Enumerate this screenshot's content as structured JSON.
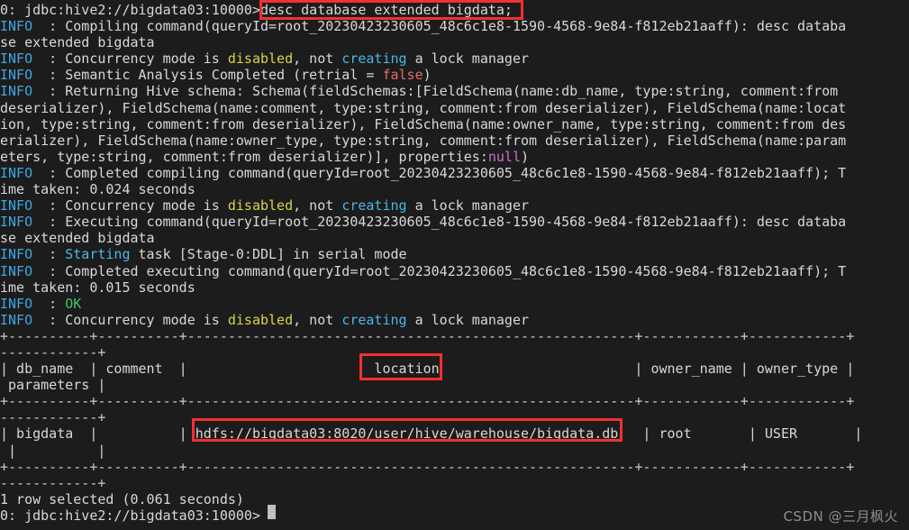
{
  "terminal": {
    "title": "hive beeline terminal",
    "prompt": "0: jdbc:hive2://bigdata03:10000>",
    "watermark": "CSDN @三月枫火",
    "colors": {
      "background": "#1c1c1c",
      "foreground": "#d8d8d8",
      "info": "#3fa7e0",
      "cyan": "#49b6e8",
      "yellow": "#d7d44a",
      "red": "#e06c6c",
      "magenta": "#d06fd0",
      "green": "#3fc66a",
      "highlight_box": "#f23030"
    },
    "command": "desc database extended bigdata;",
    "query_id": "root_20230423230605_48c6c1e8-1590-4568-9e84-f812eb21aaff",
    "compile_time": "0.024 seconds",
    "execute_time": "0.015 seconds",
    "result_status": "1 row selected (0.061 seconds)",
    "lines": [
      [
        {
          "t": "0: jdbc:hive2://bigdata03:10000>",
          "c": "c-default"
        },
        {
          "t": "desc database extended bigdata;",
          "c": "c-default"
        }
      ],
      [
        {
          "t": "INFO",
          "c": "c-info"
        },
        {
          "t": "  : Compiling command(queryId=root_20230423230605_48c6c1e8-1590-4568-9e84-f812eb21aaff): desc databa",
          "c": "c-default"
        }
      ],
      [
        {
          "t": "se extended bigdata",
          "c": "c-default"
        }
      ],
      [
        {
          "t": "INFO",
          "c": "c-info"
        },
        {
          "t": "  : Concurrency mode is ",
          "c": "c-default"
        },
        {
          "t": "disabled",
          "c": "c-yellow"
        },
        {
          "t": ", not ",
          "c": "c-default"
        },
        {
          "t": "creating",
          "c": "c-cyan"
        },
        {
          "t": " a lock manager",
          "c": "c-default"
        }
      ],
      [
        {
          "t": "INFO",
          "c": "c-info"
        },
        {
          "t": "  : Semantic Analysis Completed (retrial = ",
          "c": "c-default"
        },
        {
          "t": "false",
          "c": "c-red"
        },
        {
          "t": ")",
          "c": "c-default"
        }
      ],
      [
        {
          "t": "INFO",
          "c": "c-info"
        },
        {
          "t": "  : Returning Hive schema: Schema(fieldSchemas:[FieldSchema(name:db_name, type:string, comment:from",
          "c": "c-default"
        }
      ],
      [
        {
          "t": "deserializer), FieldSchema(name:comment, type:string, comment:from deserializer), FieldSchema(name:locat",
          "c": "c-default"
        }
      ],
      [
        {
          "t": "ion, type:string, comment:from deserializer), FieldSchema(name:owner_name, type:string, comment:from des",
          "c": "c-default"
        }
      ],
      [
        {
          "t": "erializer), FieldSchema(name:owner_type, type:string, comment:from deserializer), FieldSchema(name:param",
          "c": "c-default"
        }
      ],
      [
        {
          "t": "eters, type:string, comment:from deserializer)], properties:",
          "c": "c-default"
        },
        {
          "t": "null",
          "c": "c-magenta"
        },
        {
          "t": ")",
          "c": "c-default"
        }
      ],
      [
        {
          "t": "INFO",
          "c": "c-info"
        },
        {
          "t": "  : Completed compiling command(queryId=root_20230423230605_48c6c1e8-1590-4568-9e84-f812eb21aaff); T",
          "c": "c-default"
        }
      ],
      [
        {
          "t": "ime taken: 0.024 seconds",
          "c": "c-default"
        }
      ],
      [
        {
          "t": "INFO",
          "c": "c-info"
        },
        {
          "t": "  : Concurrency mode is ",
          "c": "c-default"
        },
        {
          "t": "disabled",
          "c": "c-yellow"
        },
        {
          "t": ", not ",
          "c": "c-default"
        },
        {
          "t": "creating",
          "c": "c-cyan"
        },
        {
          "t": " a lock manager",
          "c": "c-default"
        }
      ],
      [
        {
          "t": "INFO",
          "c": "c-info"
        },
        {
          "t": "  : Executing command(queryId=root_20230423230605_48c6c1e8-1590-4568-9e84-f812eb21aaff): desc databa",
          "c": "c-default"
        }
      ],
      [
        {
          "t": "se extended bigdata",
          "c": "c-default"
        }
      ],
      [
        {
          "t": "INFO",
          "c": "c-info"
        },
        {
          "t": "  : ",
          "c": "c-default"
        },
        {
          "t": "Starting",
          "c": "c-cyan"
        },
        {
          "t": " task [Stage-0:DDL] in serial mode",
          "c": "c-default"
        }
      ],
      [
        {
          "t": "INFO",
          "c": "c-info"
        },
        {
          "t": "  : Completed executing command(queryId=root_20230423230605_48c6c1e8-1590-4568-9e84-f812eb21aaff); T",
          "c": "c-default"
        }
      ],
      [
        {
          "t": "ime taken: 0.015 seconds",
          "c": "c-default"
        }
      ],
      [
        {
          "t": "INFO",
          "c": "c-info"
        },
        {
          "t": "  : ",
          "c": "c-default"
        },
        {
          "t": "OK",
          "c": "c-green"
        }
      ],
      [
        {
          "t": "INFO",
          "c": "c-info"
        },
        {
          "t": "  : Concurrency mode is ",
          "c": "c-default"
        },
        {
          "t": "disabled",
          "c": "c-yellow"
        },
        {
          "t": ", not ",
          "c": "c-default"
        },
        {
          "t": "creating",
          "c": "c-cyan"
        },
        {
          "t": " a lock manager",
          "c": "c-default"
        }
      ],
      [
        {
          "t": "+----------+----------+-------------------------------------------------------+------------+------------+",
          "c": "c-sep"
        }
      ],
      [
        {
          "t": "------------+",
          "c": "c-sep"
        }
      ],
      [
        {
          "t": "| db_name  | comment  |                       location                        | owner_name | owner_type |",
          "c": "c-default"
        }
      ],
      [
        {
          "t": " parameters |",
          "c": "c-default"
        }
      ],
      [
        {
          "t": "+----------+----------+-------------------------------------------------------+------------+------------+",
          "c": "c-sep"
        }
      ],
      [
        {
          "t": "------------+",
          "c": "c-sep"
        }
      ],
      [
        {
          "t": "| bigdata  |          | hdfs://bigdata03:8020/user/hive/warehouse/bigdata.db   | root       | USER       |",
          "c": "c-default"
        }
      ],
      [
        {
          "t": " |          |",
          "c": "c-default"
        }
      ],
      [
        {
          "t": "+----------+----------+-------------------------------------------------------+------------+------------+",
          "c": "c-sep"
        }
      ],
      [
        {
          "t": "------------+",
          "c": "c-sep"
        }
      ],
      [
        {
          "t": "1 row selected (0.061 seconds)",
          "c": "c-default"
        }
      ],
      [
        {
          "t": "0: jdbc:hive2://bigdata03:10000> ",
          "c": "c-default"
        }
      ]
    ],
    "table": {
      "headers": [
        "db_name",
        "comment",
        "location",
        "owner_name",
        "owner_type",
        "parameters"
      ],
      "rows": [
        {
          "db_name": "bigdata",
          "comment": "",
          "location": "hdfs://bigdata03:8020/user/hive/warehouse/bigdata.db",
          "owner_name": "root",
          "owner_type": "USER",
          "parameters": ""
        }
      ]
    },
    "annotations": [
      {
        "name": "command-highlight",
        "label": "desc database extended bigdata;"
      },
      {
        "name": "location-column-highlight",
        "label": "location"
      },
      {
        "name": "hdfs-path-highlight",
        "label": "hdfs://bigdata03:8020/user/hive/warehouse/bigdata.db"
      }
    ]
  }
}
